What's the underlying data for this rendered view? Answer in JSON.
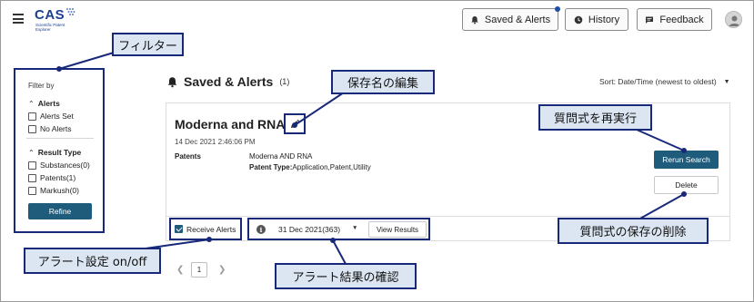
{
  "header": {
    "logo_text": "CAS",
    "logo_subtitle": "Scientific Patent Explorer",
    "buttons": {
      "saved_alerts": "Saved & Alerts",
      "history": "History",
      "feedback": "Feedback"
    }
  },
  "sidebar": {
    "filter_by": "Filter by",
    "alerts_title": "Alerts",
    "alerts_options": [
      "Alerts Set",
      "No Alerts"
    ],
    "result_type_title": "Result Type",
    "result_type_options": [
      "Substances(0)",
      "Patents(1)",
      "Markush(0)"
    ],
    "refine_label": "Refine"
  },
  "main": {
    "title": "Saved & Alerts",
    "count": "(1)",
    "sort_label": "Sort:  Date/Time (newest to oldest)"
  },
  "card": {
    "name": "Moderna and RNA",
    "date": "14 Dec 2021 2:46:06 PM",
    "row_label": "Patents",
    "row_value": "Moderna AND RNA",
    "patent_type_label": "Patent Type:",
    "patent_type_value": "Application,Patent,Utility",
    "rerun_label": "Rerun Search",
    "delete_label": "Delete",
    "receive_alerts_label": "Receive Alerts",
    "result_date": "31 Dec 2021(363)",
    "view_results_label": "View Results"
  },
  "pagination": {
    "current_page": "1"
  },
  "callouts": {
    "filter": "フィルター",
    "edit_name": "保存名の編集",
    "rerun": "質問式を再実行",
    "delete": "質問式の保存の削除",
    "alert_setting": "アラート設定 on/off",
    "confirm_results": "アラート結果の確認"
  },
  "colors": {
    "primary_button": "#1f5c7c",
    "callout_fill": "#dce6f2",
    "callout_border": "#18297a",
    "logo": "#1d3f8f"
  }
}
